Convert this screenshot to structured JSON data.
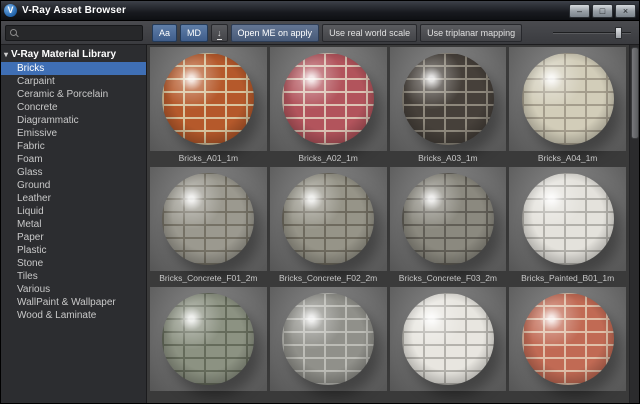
{
  "window": {
    "title": "V-Ray Asset Browser"
  },
  "icons": {
    "logo": "V",
    "minimize": "–",
    "maximize": "□",
    "close": "×",
    "tree_expanded": "▾",
    "download_arrow": "↓",
    "search": "magnifier-css-shape"
  },
  "toolbar": {
    "search_value": "",
    "buttons": {
      "aa": "Aa",
      "md": "MD",
      "open_me": "Open ME on apply",
      "real_world": "Use real world scale",
      "triplanar": "Use triplanar mapping"
    },
    "preview_size_slider": {
      "position_percent": 80
    }
  },
  "sidebar": {
    "root": "V-Ray Material Library",
    "items": [
      {
        "label": "Bricks",
        "selected": true
      },
      {
        "label": "Carpaint",
        "selected": false
      },
      {
        "label": "Ceramic & Porcelain",
        "selected": false
      },
      {
        "label": "Concrete",
        "selected": false
      },
      {
        "label": "Diagrammatic",
        "selected": false
      },
      {
        "label": "Emissive",
        "selected": false
      },
      {
        "label": "Fabric",
        "selected": false
      },
      {
        "label": "Foam",
        "selected": false
      },
      {
        "label": "Glass",
        "selected": false
      },
      {
        "label": "Ground",
        "selected": false
      },
      {
        "label": "Leather",
        "selected": false
      },
      {
        "label": "Liquid",
        "selected": false
      },
      {
        "label": "Metal",
        "selected": false
      },
      {
        "label": "Paper",
        "selected": false
      },
      {
        "label": "Plastic",
        "selected": false
      },
      {
        "label": "Stone",
        "selected": false
      },
      {
        "label": "Tiles",
        "selected": false
      },
      {
        "label": "Various",
        "selected": false
      },
      {
        "label": "WallPaint & Wallpaper",
        "selected": false
      },
      {
        "label": "Wood & Laminate",
        "selected": false
      }
    ]
  },
  "materials": [
    {
      "label": "Bricks_A01_1m",
      "brick": "#b5592b",
      "mortar": "#d8c49e"
    },
    {
      "label": "Bricks_A02_1m",
      "brick": "#b2545c",
      "mortar": "#dcc3b4"
    },
    {
      "label": "Bricks_A03_1m",
      "brick": "#46403a",
      "mortar": "#8e887c"
    },
    {
      "label": "Bricks_A04_1m",
      "brick": "#d2cdb9",
      "mortar": "#a49d8c"
    },
    {
      "label": "Bricks_Concrete_F01_2m",
      "brick": "#9b998f",
      "mortar": "#757165"
    },
    {
      "label": "Bricks_Concrete_F02_2m",
      "brick": "#969488",
      "mortar": "#6e6a5e"
    },
    {
      "label": "Bricks_Concrete_F03_2m",
      "brick": "#8b897f",
      "mortar": "#615e56"
    },
    {
      "label": "Bricks_Painted_B01_1m",
      "brick": "#e4e2dc",
      "mortar": "#b2b0aa"
    },
    {
      "label": "",
      "brick": "#8c9282",
      "mortar": "#656b5b"
    },
    {
      "label": "",
      "brick": "#90908a",
      "mortar": "#bcbcb6"
    },
    {
      "label": "",
      "brick": "#e8e6e0",
      "mortar": "#b4b2ac"
    },
    {
      "label": "",
      "brick": "#c16a54",
      "mortar": "#e0bfa8"
    }
  ]
}
